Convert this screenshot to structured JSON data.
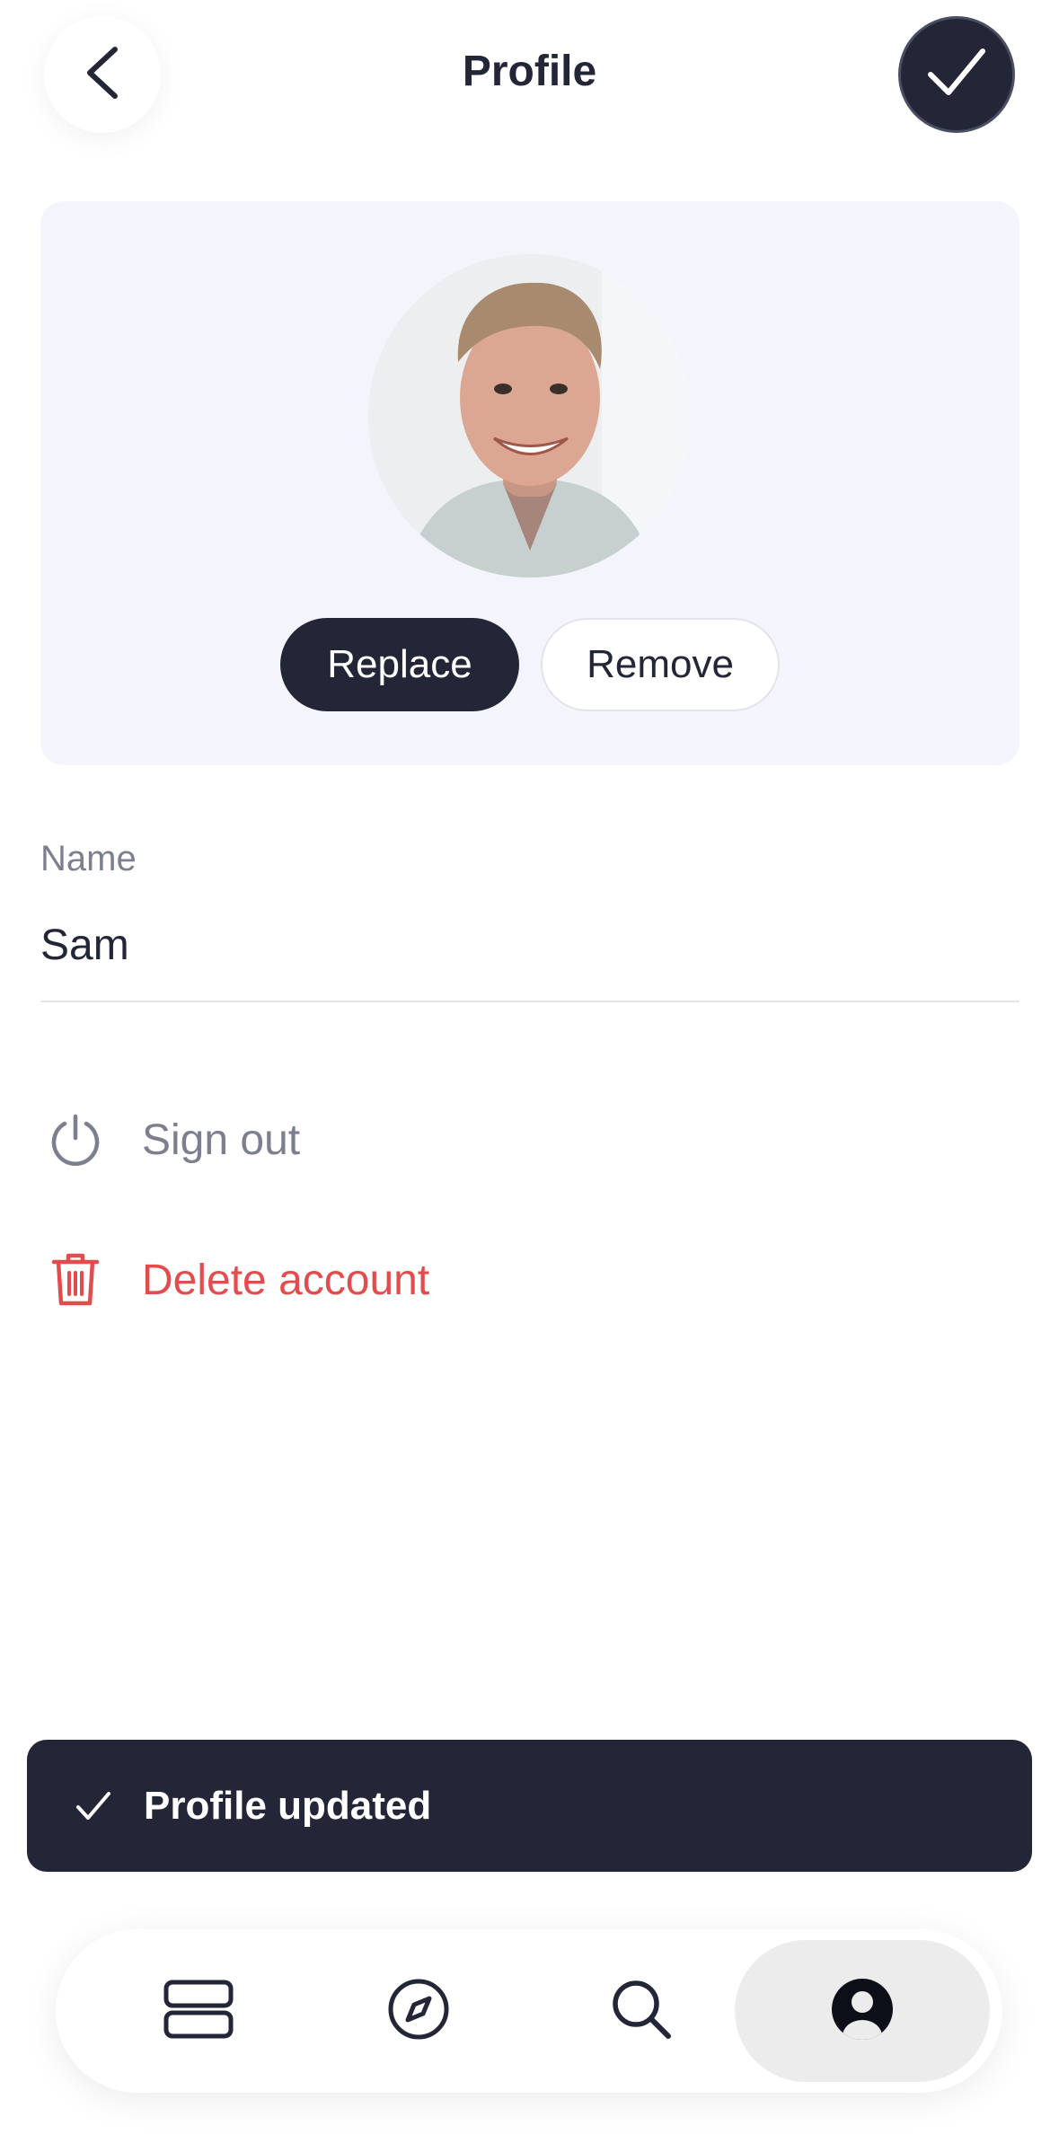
{
  "header": {
    "title": "Profile",
    "back_icon": "chevron-left-icon",
    "save_icon": "check-icon"
  },
  "avatar_card": {
    "replace_label": "Replace",
    "remove_label": "Remove"
  },
  "name_field": {
    "label": "Name",
    "value": "Sam"
  },
  "actions": {
    "sign_out": {
      "label": "Sign out",
      "icon": "power-icon"
    },
    "delete_account": {
      "label": "Delete account",
      "icon": "trash-icon"
    }
  },
  "toast": {
    "message": "Profile updated",
    "icon": "check-icon"
  },
  "tabbar": {
    "items": [
      {
        "icon": "library-icon",
        "active": false
      },
      {
        "icon": "compass-icon",
        "active": false
      },
      {
        "icon": "search-icon",
        "active": false
      },
      {
        "icon": "account-icon",
        "active": true
      }
    ]
  },
  "colors": {
    "primary": "#232637",
    "danger": "#e34c4c",
    "muted": "#7c7f8e",
    "card_bg": "#f4f5fc"
  }
}
